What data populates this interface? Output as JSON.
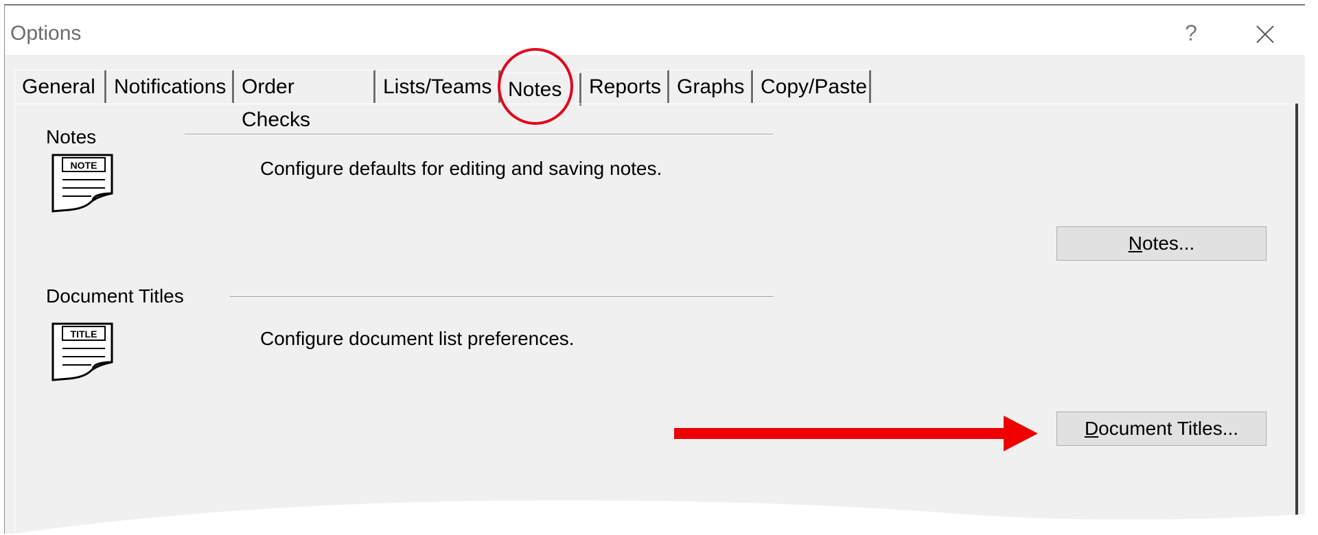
{
  "dialog": {
    "title": "Options",
    "help_glyph": "?",
    "close_icon": "close-icon"
  },
  "tabs": [
    {
      "label": "General"
    },
    {
      "label": "Notifications"
    },
    {
      "label": "Order Checks"
    },
    {
      "label": "Lists/Teams"
    },
    {
      "label": "Notes",
      "active": true
    },
    {
      "label": "Reports"
    },
    {
      "label": "Graphs"
    },
    {
      "label": "Copy/Paste"
    }
  ],
  "sections": {
    "notes": {
      "heading": "Notes",
      "icon_text": "NOTE",
      "description": "Configure defaults for editing and saving notes.",
      "button_mnemonic": "N",
      "button_rest": "otes..."
    },
    "document_titles": {
      "heading": "Document Titles",
      "icon_text": "TITLE",
      "description": "Configure document list preferences.",
      "button_mnemonic": "D",
      "button_rest": "ocument Titles..."
    }
  },
  "annotations": {
    "circle_color": "#e3001b",
    "arrow_color": "#ee0000"
  }
}
